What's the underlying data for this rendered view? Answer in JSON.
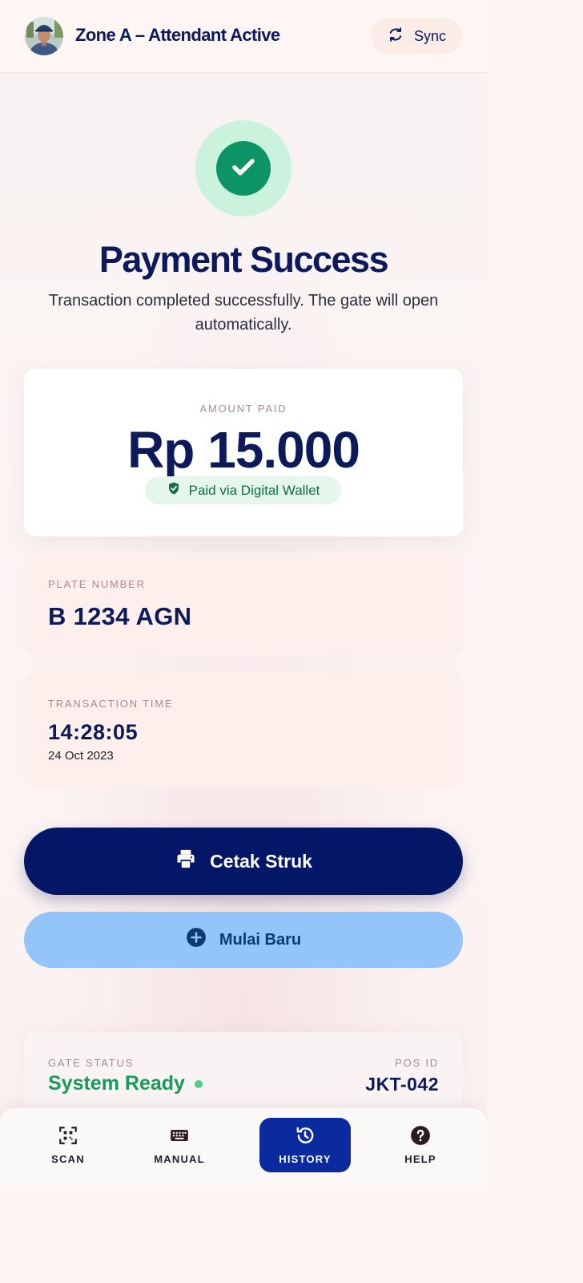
{
  "header": {
    "title": "Zone A – Attendant Active",
    "sync_label": "Sync"
  },
  "status": {
    "title": "Payment Success",
    "message": "Transaction completed successfully. The gate will open automatically."
  },
  "amount": {
    "label": "AMOUNT PAID",
    "value": "Rp 15.000",
    "method": "Paid via Digital Wallet"
  },
  "plate": {
    "label": "PLATE NUMBER",
    "value": "B 1234 AGN"
  },
  "transaction_time": {
    "label": "TRANSACTION TIME",
    "time": "14:28:05",
    "date": "24 Oct 2023"
  },
  "actions": {
    "print_label": "Cetak Struk",
    "new_label": "Mulai Baru"
  },
  "gate": {
    "status_label": "GATE STATUS",
    "status_value": "System Ready",
    "pos_label": "POS ID",
    "pos_value": "JKT-042"
  },
  "nav": {
    "items": [
      {
        "label": "SCAN",
        "icon": "qr-scan-icon",
        "active": false
      },
      {
        "label": "MANUAL",
        "icon": "keyboard-icon",
        "active": false
      },
      {
        "label": "HISTORY",
        "icon": "history-icon",
        "active": true
      },
      {
        "label": "HELP",
        "icon": "help-icon",
        "active": false
      }
    ]
  },
  "colors": {
    "primary": "#041766",
    "success": "#0d9466",
    "accent_light": "#93c4fa",
    "active_nav": "#0b2a9e"
  }
}
